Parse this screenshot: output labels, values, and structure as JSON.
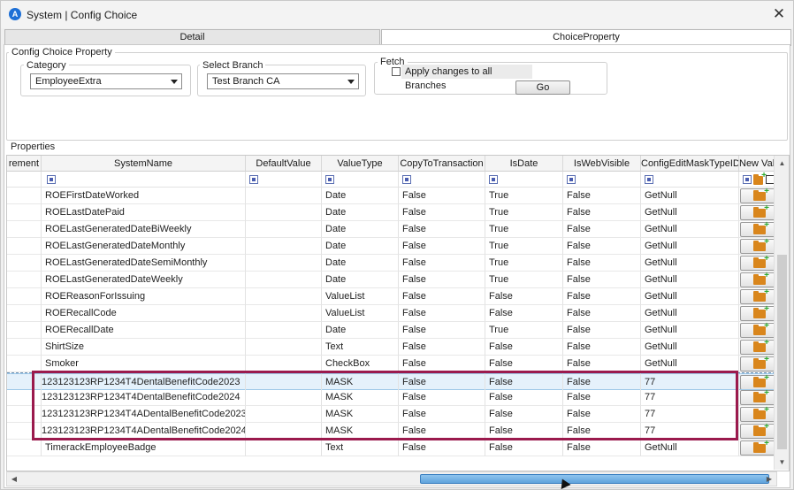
{
  "window": {
    "title": "System | Config Choice",
    "close_glyph": "✕"
  },
  "tabs": [
    {
      "label": "Detail"
    },
    {
      "label": "ChoiceProperty"
    }
  ],
  "config_group": {
    "legend": "Config Choice Property",
    "category": {
      "label": "Category",
      "value": "EmployeeExtra"
    },
    "branch": {
      "label": "Select Branch",
      "value": "Test Branch CA"
    },
    "fetch": {
      "label": "Fetch",
      "apply_all_label": "Apply changes to all Branches",
      "go_label": "Go"
    }
  },
  "properties": {
    "label": "Properties",
    "columns": [
      "rement",
      "SystemName",
      "DefaultValue",
      "ValueType",
      "CopyToTransaction",
      "IsDate",
      "IsWebVisible",
      "ConfigEditMaskTypeID",
      "New Val"
    ],
    "rows": [
      {
        "name": "ROEFirstDateWorked",
        "default": "",
        "type": "Date",
        "copy": "False",
        "isdate": "True",
        "web": "False",
        "mask": "GetNull"
      },
      {
        "name": "ROELastDatePaid",
        "default": "",
        "type": "Date",
        "copy": "False",
        "isdate": "True",
        "web": "False",
        "mask": "GetNull"
      },
      {
        "name": "ROELastGeneratedDateBiWeekly",
        "default": "",
        "type": "Date",
        "copy": "False",
        "isdate": "True",
        "web": "False",
        "mask": "GetNull"
      },
      {
        "name": "ROELastGeneratedDateMonthly",
        "default": "",
        "type": "Date",
        "copy": "False",
        "isdate": "True",
        "web": "False",
        "mask": "GetNull"
      },
      {
        "name": "ROELastGeneratedDateSemiMonthly",
        "default": "",
        "type": "Date",
        "copy": "False",
        "isdate": "True",
        "web": "False",
        "mask": "GetNull"
      },
      {
        "name": "ROELastGeneratedDateWeekly",
        "default": "",
        "type": "Date",
        "copy": "False",
        "isdate": "True",
        "web": "False",
        "mask": "GetNull"
      },
      {
        "name": "ROEReasonForIssuing",
        "default": "",
        "type": "ValueList",
        "copy": "False",
        "isdate": "False",
        "web": "False",
        "mask": "GetNull"
      },
      {
        "name": "ROERecallCode",
        "default": "",
        "type": "ValueList",
        "copy": "False",
        "isdate": "False",
        "web": "False",
        "mask": "GetNull"
      },
      {
        "name": "ROERecallDate",
        "default": "",
        "type": "Date",
        "copy": "False",
        "isdate": "True",
        "web": "False",
        "mask": "GetNull"
      },
      {
        "name": "ShirtSize",
        "default": "",
        "type": "Text",
        "copy": "False",
        "isdate": "False",
        "web": "False",
        "mask": "GetNull"
      },
      {
        "name": "Smoker",
        "default": "",
        "type": "CheckBox",
        "copy": "False",
        "isdate": "False",
        "web": "False",
        "mask": "GetNull"
      },
      {
        "name": "123123123RP1234T4DentalBenefitCode2023",
        "default": "",
        "type": "MASK",
        "copy": "False",
        "isdate": "False",
        "web": "False",
        "mask": "77"
      },
      {
        "name": "123123123RP1234T4DentalBenefitCode2024",
        "default": "",
        "type": "MASK",
        "copy": "False",
        "isdate": "False",
        "web": "False",
        "mask": "77"
      },
      {
        "name": "123123123RP1234T4ADentalBenefitCode2023",
        "default": "",
        "type": "MASK",
        "copy": "False",
        "isdate": "False",
        "web": "False",
        "mask": "77"
      },
      {
        "name": "123123123RP1234T4ADentalBenefitCode2024",
        "default": "",
        "type": "MASK",
        "copy": "False",
        "isdate": "False",
        "web": "False",
        "mask": "77"
      },
      {
        "name": "TimerackEmployeeBadge",
        "default": "",
        "type": "Text",
        "copy": "False",
        "isdate": "False",
        "web": "False",
        "mask": "GetNull"
      }
    ]
  },
  "colors": {
    "highlight": "#9b1a4d",
    "selection": "#e5f1fb",
    "scroll_thumb": "#5fa3dc"
  }
}
